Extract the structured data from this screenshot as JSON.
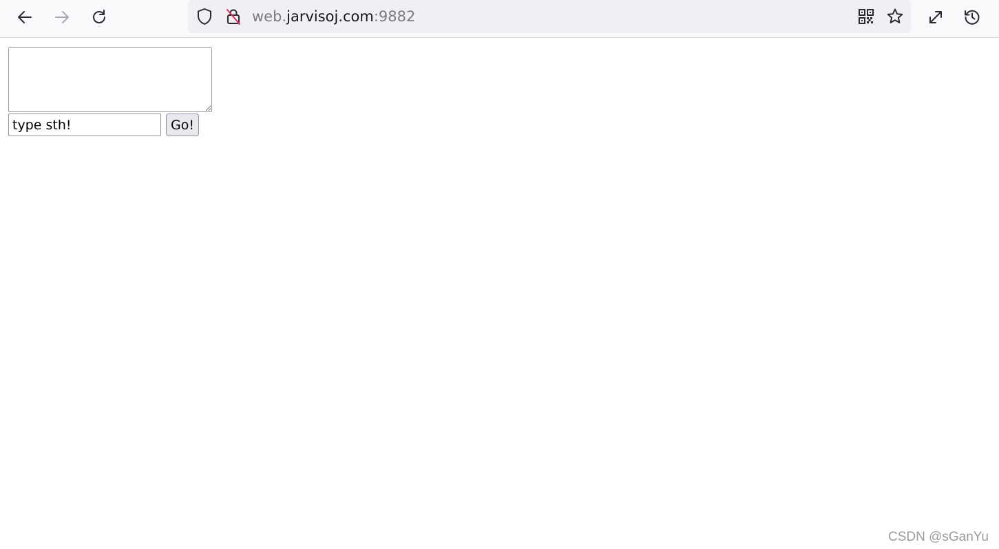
{
  "browser": {
    "url": {
      "prefix": "web.",
      "host": "jarvisoj.com",
      "port": ":9882"
    },
    "icons": {
      "back": "back-arrow-icon",
      "forward": "forward-arrow-icon",
      "reload": "reload-icon",
      "tracking_protection": "shield-icon",
      "connection": "insecure-lock-icon",
      "qr": "qr-code-icon",
      "bookmark": "star-icon",
      "fullscreen": "expand-icon",
      "history": "history-icon"
    }
  },
  "form": {
    "textarea_value": "",
    "input_value": "type sth!",
    "button_label": "Go!"
  },
  "watermark": "CSDN @sGanYu"
}
